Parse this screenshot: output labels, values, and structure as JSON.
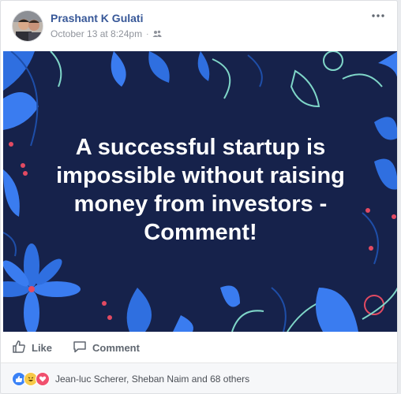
{
  "post": {
    "author": "Prashant K Gulati",
    "timestamp": "October 13 at 8:24pm",
    "separator": "·",
    "audience_icon": "friends-icon",
    "more_icon": "more-options-icon",
    "media_text": "A successful startup is impossible without raising money from investors - Comment!",
    "colors": {
      "author": "#385898",
      "media_background": "#16224b",
      "leaf_blue": "#2f6fe0",
      "accent_red": "#e24a62",
      "stroke_teal": "#7fd6c8"
    }
  },
  "actions": {
    "like_label": "Like",
    "comment_label": "Comment",
    "like_icon": "thumbs-up-icon",
    "comment_icon": "comment-bubble-icon"
  },
  "reactions": {
    "icons": [
      "like-reaction-icon",
      "haha-reaction-icon",
      "love-reaction-icon"
    ],
    "summary": "Jean-luc Scherer, Sheban Naim and 68 others"
  }
}
